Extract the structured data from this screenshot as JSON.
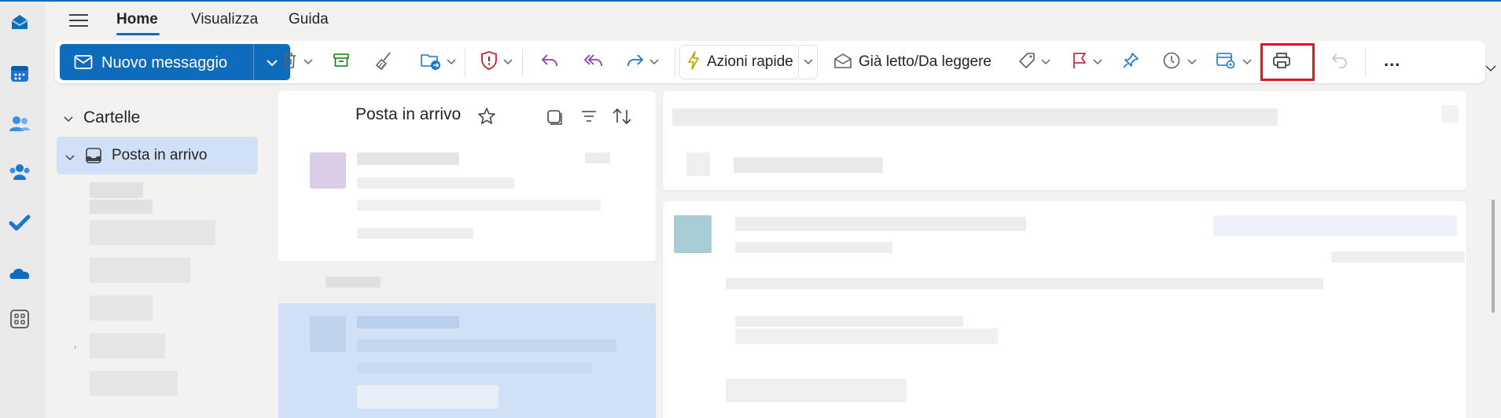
{
  "nav": {
    "tabs": [
      {
        "label": "Home",
        "active": true
      },
      {
        "label": "Visualizza",
        "active": false
      },
      {
        "label": "Guida",
        "active": false
      }
    ]
  },
  "ribbon": {
    "new_message_label": "Nuovo messaggio",
    "quick_actions_label": "Azioni rapide",
    "read_unread_label": "Già letto/Da leggere",
    "more_label": "..."
  },
  "folders": {
    "title": "Cartelle",
    "inbox_label": "Posta in arrivo"
  },
  "message_list": {
    "title": "Posta in arrivo"
  },
  "colors": {
    "accent": "#0f6cbd",
    "selected": "#cfe0f7",
    "highlight": "#e0161b",
    "flag": "#c4314b"
  }
}
